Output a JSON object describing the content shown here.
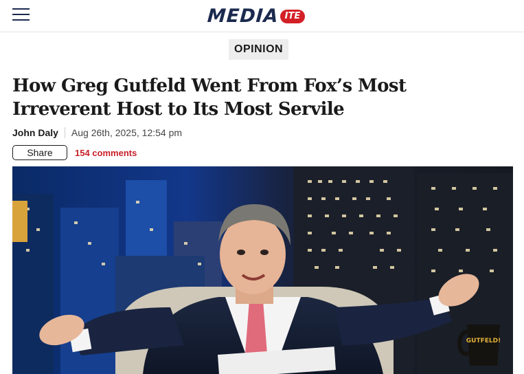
{
  "header": {
    "menu_icon": "hamburger-menu-icon",
    "logo_text": "MEDIA",
    "logo_badge": "ITE"
  },
  "article": {
    "section": "OPINION",
    "headline": "How Greg Gutfeld Went From Fox’s Most Irreverent Host to Its Most Servile",
    "author": "John Daly",
    "date": "Aug 26th, 2025, 12:54 pm",
    "share_label": "Share",
    "comments_label": "154 comments"
  },
  "hero_image": {
    "mug_text": "GUTFELD!"
  },
  "colors": {
    "brand_navy": "#1b2a4e",
    "brand_red": "#d32027",
    "comments_red": "#c8202a",
    "tag_bg": "#ededed"
  }
}
